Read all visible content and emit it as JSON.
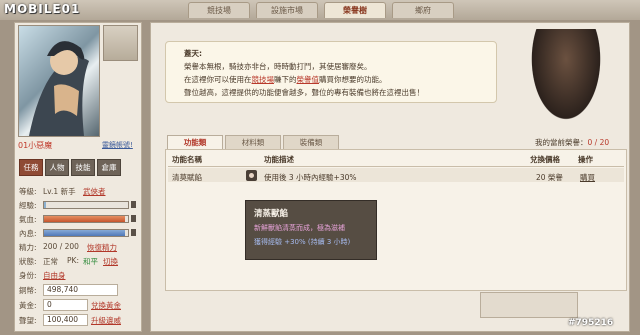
{
  "logo": "MOBILE01",
  "watermark": "#795216",
  "tabs": [
    "競技場",
    "設施市場",
    "榮譽樹",
    "鄉府"
  ],
  "active_tab": 2,
  "left": {
    "char_name": "01小惡魔",
    "edit_link": "靈鏡帳號!",
    "buttons": [
      "任務",
      "人物",
      "技能",
      "倉庫"
    ],
    "title_label": "等級:",
    "title_value": "Lv.1 新手",
    "title_link": "武俠者",
    "hp_label": "經驗:",
    "mp_label": "氣血:",
    "ip_label": "內息:",
    "stamina_label": "精力:",
    "stamina_value": "200 / 200",
    "stamina_link": "恢復精力",
    "status_label": "狀態:",
    "status_value": "正常",
    "pk_label": "PK:",
    "pk_value": "和平",
    "pk_link": "切換",
    "identity_label": "身份:",
    "identity_value": "自由身",
    "money1_label": "銅幣:",
    "money1_value": "498,740",
    "money2_label": "黃金:",
    "money2_value": "0",
    "money2_link": "兌換黃金",
    "money3_label": "聲望:",
    "money3_value": "100,400",
    "money3_link": "升級邊威",
    "bars": {
      "exp": 0.02,
      "hp": 0.96,
      "mp": 0.96
    }
  },
  "dialog": {
    "speaker": "蓋天:",
    "line1": "榮譽本無根，騎技亦非台，時時動打鬥，其使居審廢矣。",
    "line2_pre": "在這裡你可以使用在",
    "line2_link1": "競技場",
    "line2_mid": "賺下的",
    "line2_link2": "榮譽值",
    "line2_post": "購買你想要的功能。",
    "line3": "聲位越高，這裡提供的功能便會越多，聲位的專有裝備也將在這裡出售！"
  },
  "honor": {
    "label": "我的當前榮譽：",
    "value": "0 / 20"
  },
  "subtabs": [
    "功能類",
    "材料類",
    "裝備類"
  ],
  "active_subtab": 0,
  "table": {
    "headers": [
      "功能名稱",
      "功能描述",
      "兌換價格",
      "操作"
    ],
    "row": {
      "name": "清莫賦餡",
      "desc": "使用後 3 小時內經驗+30%",
      "price": "20 榮譽",
      "action": "購買"
    }
  },
  "tooltip": {
    "title": "清蒸獸餡",
    "line1": "新鮮獸餡清蒸而成，極為滋補",
    "line2": "獲得經驗 +30% (持續 3 小時)"
  }
}
